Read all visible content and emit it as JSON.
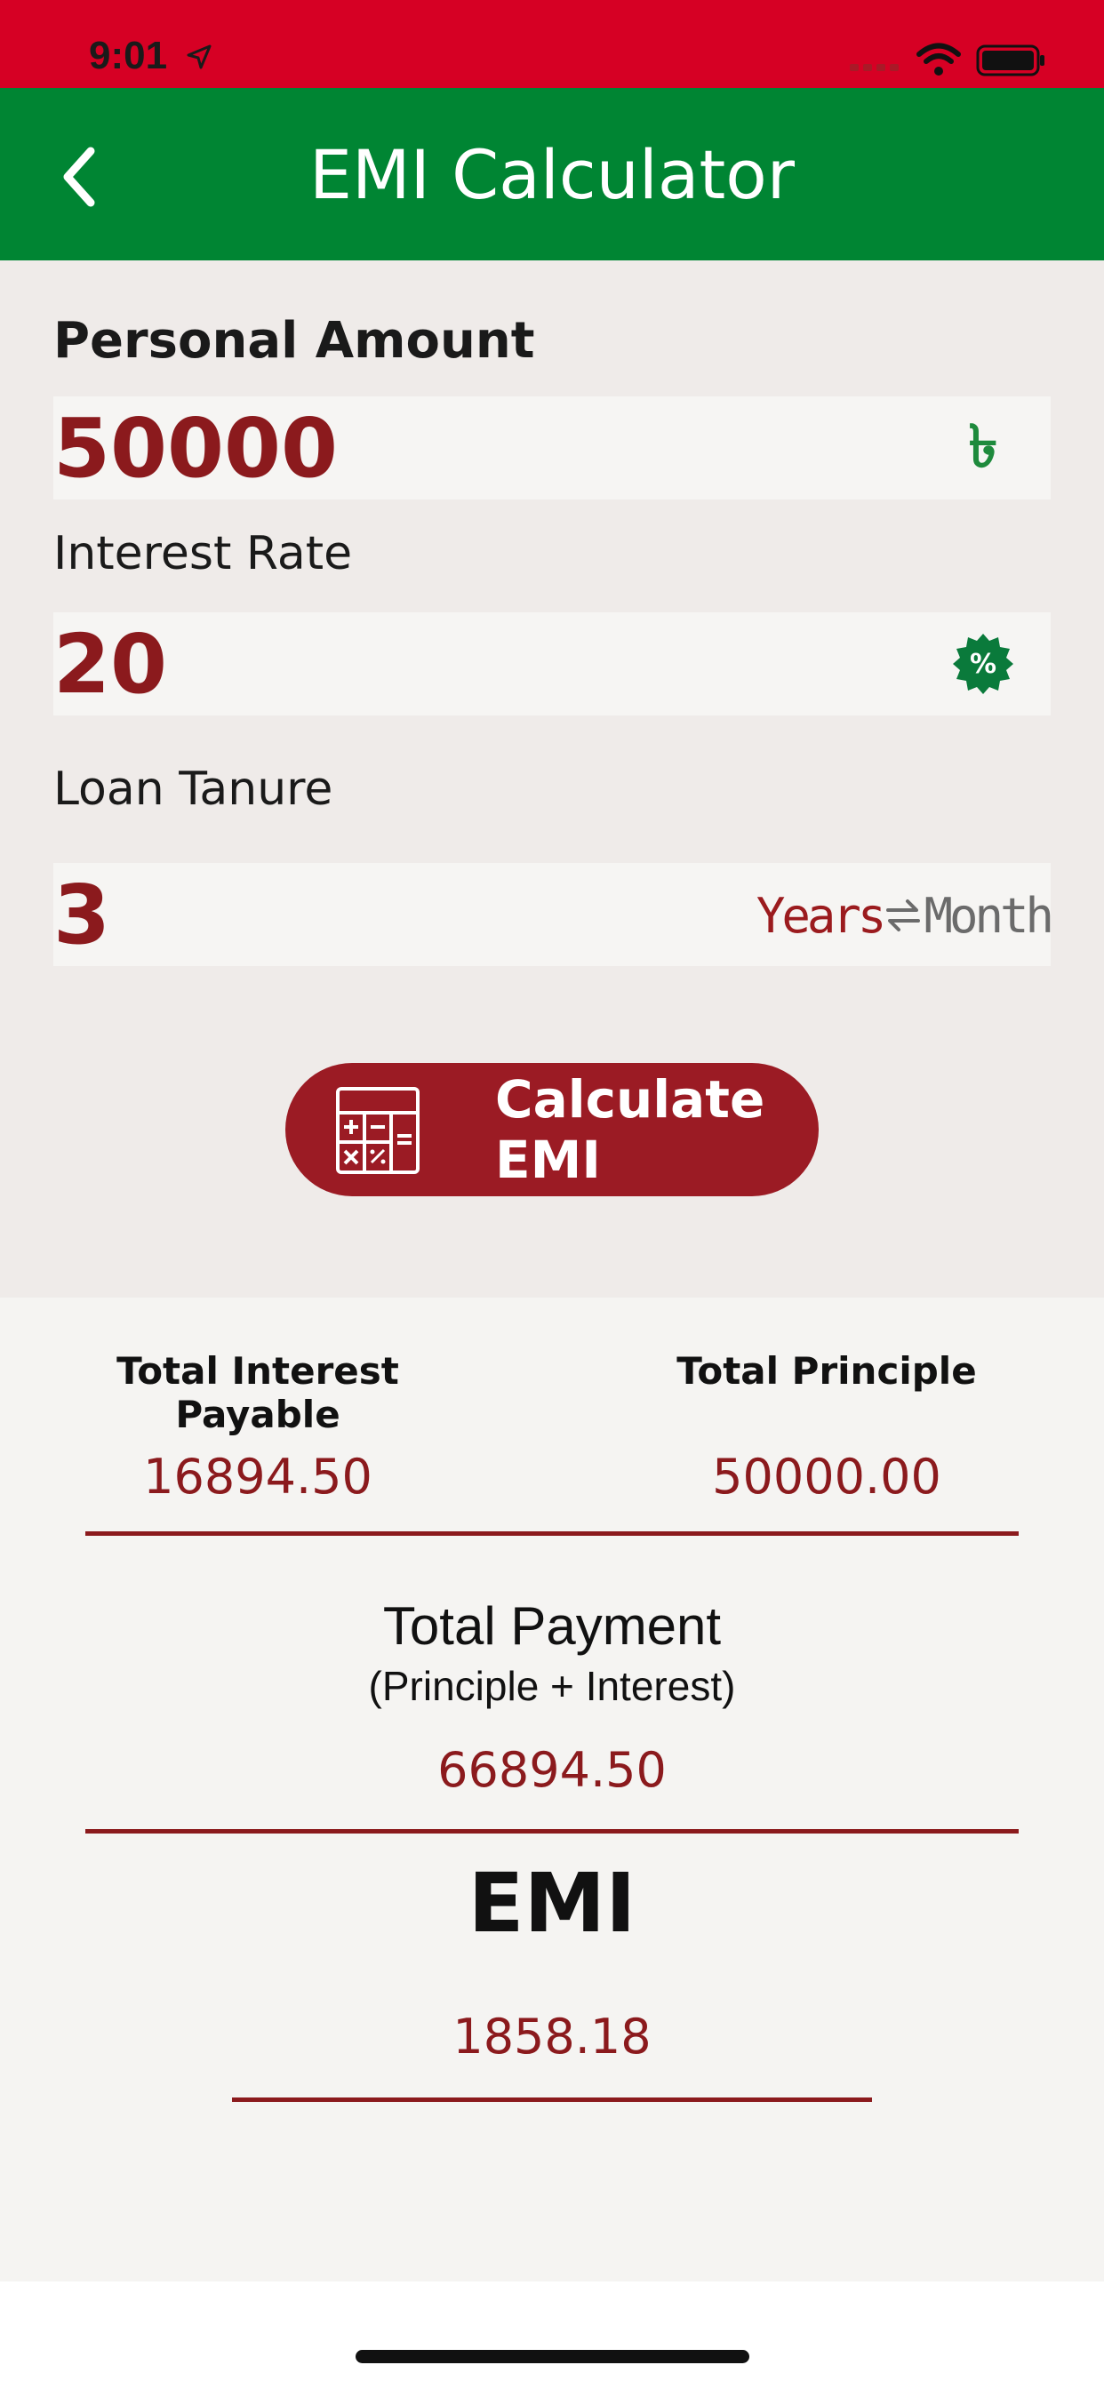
{
  "status_bar": {
    "time": "9:01",
    "background_color": "#D60024",
    "icons": [
      "location-icon",
      "signal-icon",
      "wifi-icon",
      "battery-icon"
    ]
  },
  "nav": {
    "title": "EMI Calculator",
    "background_color": "#008533",
    "back_icon": "chevron-left-icon"
  },
  "form": {
    "amount": {
      "label": "Personal Amount",
      "value": "50000",
      "icon": "taka-icon",
      "symbol": "৳"
    },
    "interest": {
      "label": "Interest Rate",
      "value": "20",
      "icon": "percent-badge-icon",
      "symbol": "%"
    },
    "tenure": {
      "label": "Loan Tanure",
      "value": "3",
      "unit_years": "Years",
      "unit_month": "Month",
      "icon": "swap-icon"
    }
  },
  "calculate_button": {
    "label": "Calculate EMI",
    "icon": "calculator-icon",
    "color": "#9B1B24"
  },
  "results": {
    "total_interest_label": "Total Interest Payable",
    "total_interest_value": "16894.50",
    "total_principle_label": "Total Principle",
    "total_principle_value": "50000.00",
    "total_payment_label": "Total Payment",
    "total_payment_sub": "(Principle + Interest)",
    "total_payment_value": "66894.50",
    "emi_label": "EMI",
    "emi_value": "1858.18",
    "value_color": "#8B1A1D"
  }
}
